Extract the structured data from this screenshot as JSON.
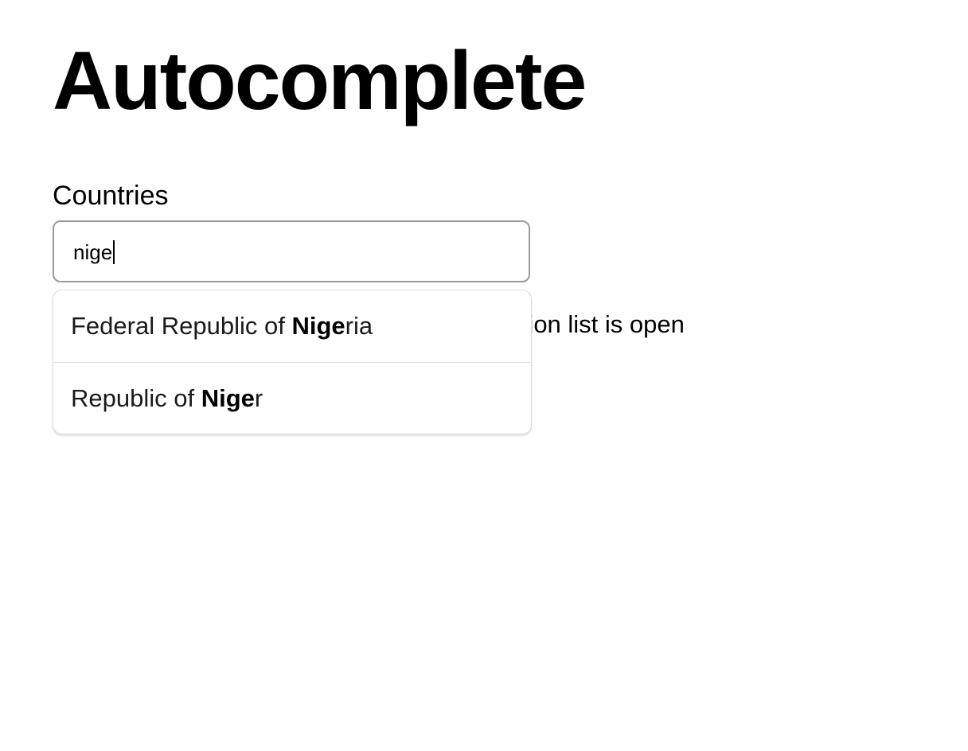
{
  "page": {
    "title": "Autocomplete"
  },
  "field": {
    "label": "Countries",
    "value": "nige"
  },
  "hint": {
    "text": "The layout is not affected when the suggestion list is open"
  },
  "suggestions": [
    {
      "before": "Federal Republic of ",
      "match": "Nige",
      "after": "ria"
    },
    {
      "before": "Republic of ",
      "match": "Nige",
      "after": "r"
    }
  ],
  "colors": {
    "input_border": "#9a9aa4",
    "list_border": "#dddde2",
    "text": "#000000"
  }
}
